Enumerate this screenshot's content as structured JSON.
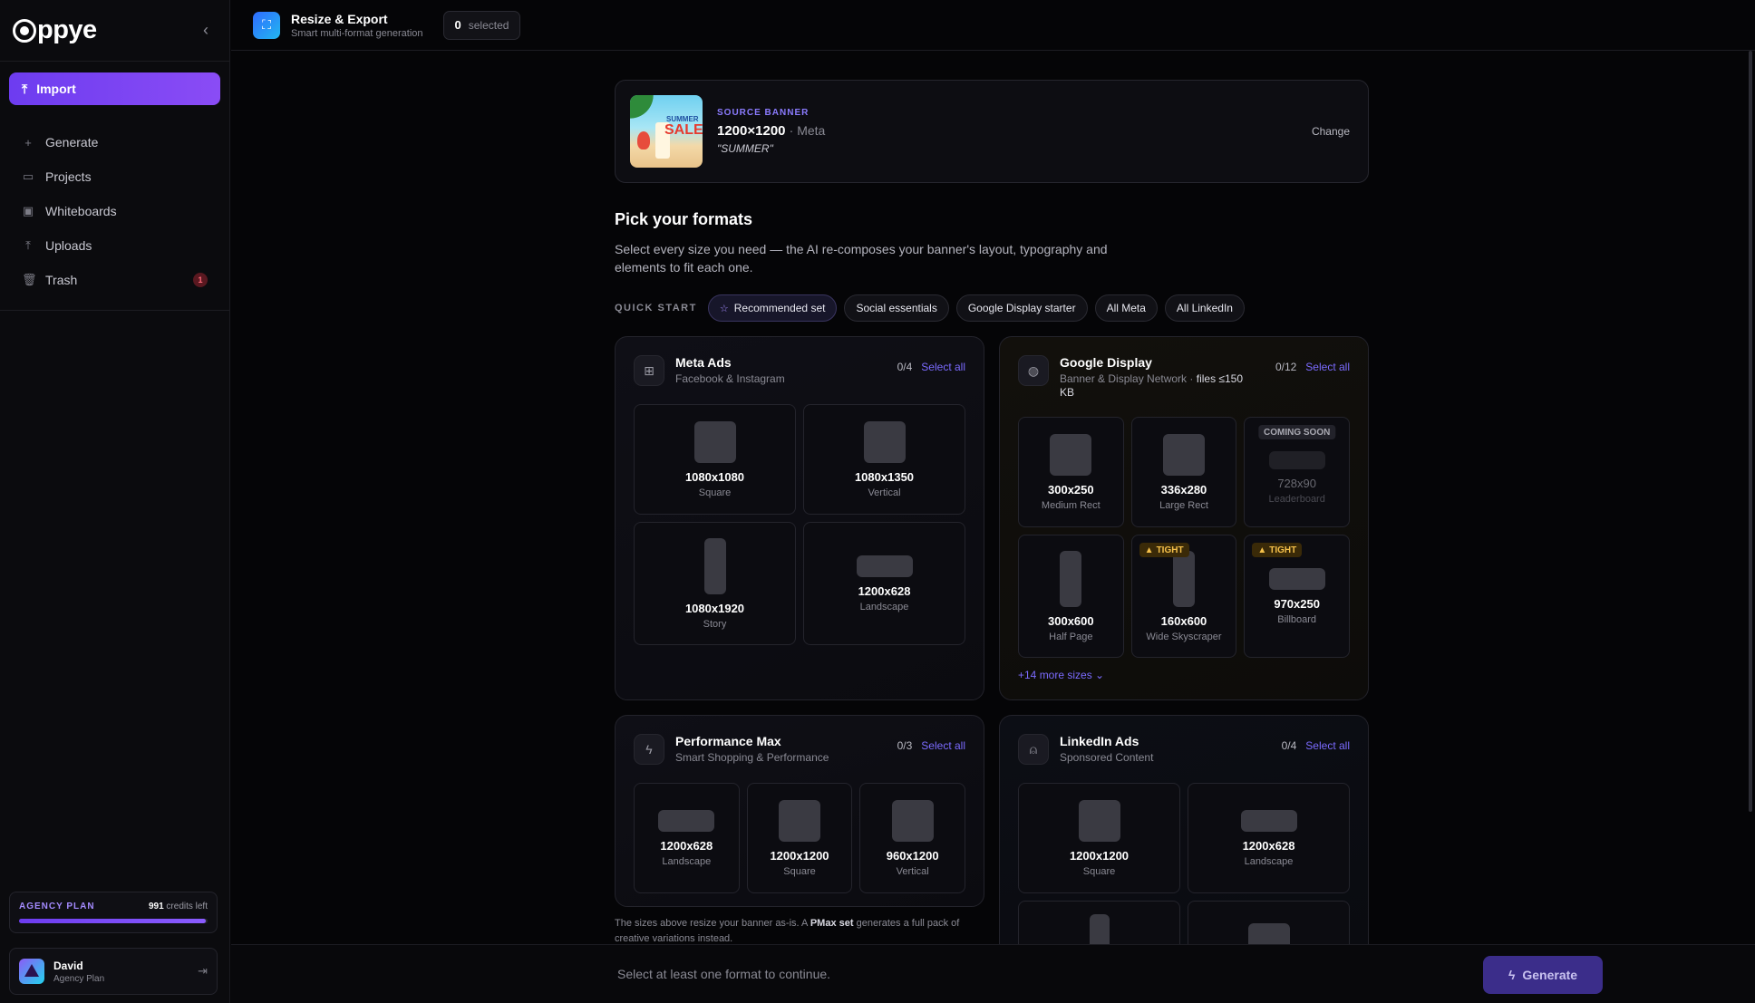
{
  "sidebar": {
    "logo": "ppye",
    "import_label": "Import",
    "items": [
      {
        "label": "Generate",
        "icon": "plus-icon"
      },
      {
        "label": "Projects",
        "icon": "folder-icon"
      },
      {
        "label": "Whiteboards",
        "icon": "whiteboard-icon"
      },
      {
        "label": "Uploads",
        "icon": "upload-icon"
      },
      {
        "label": "Trash",
        "icon": "trash-icon",
        "badge": "1"
      }
    ],
    "plan": {
      "name": "AGENCY PLAN",
      "credits": "991",
      "credits_suffix": "credits left",
      "usage_fraction": 0.99
    },
    "user": {
      "name": "David",
      "plan": "Agency Plan"
    }
  },
  "topbar": {
    "title": "Resize & Export",
    "subtitle": "Smart multi-format generation",
    "selected_count": "0",
    "selected_label": "selected"
  },
  "source": {
    "label": "SOURCE BANNER",
    "size": "1200×1200",
    "platform": "· Meta",
    "name": "\"SUMMER\"",
    "change_label": "Change",
    "thumb_text_top": "SUMMER",
    "thumb_text_big": "SALE"
  },
  "formats": {
    "title": "Pick your formats",
    "description": "Select every size you need — the AI re-composes your banner's layout, typography and elements to fit each one.",
    "quick_start_label": "QUICK START",
    "chips": [
      "Recommended set",
      "Social essentials",
      "Google Display starter",
      "All Meta",
      "All LinkedIn"
    ]
  },
  "groups": {
    "meta": {
      "title": "Meta Ads",
      "subtitle": "Facebook & Instagram",
      "count": "0/4",
      "select_all": "Select all",
      "tiles": [
        {
          "dim": "1080x1080",
          "name": "Square"
        },
        {
          "dim": "1080x1350",
          "name": "Vertical"
        },
        {
          "dim": "1080x1920",
          "name": "Story"
        },
        {
          "dim": "1200x628",
          "name": "Landscape"
        }
      ]
    },
    "google": {
      "title": "Google Display",
      "subtitle": "Banner & Display Network ·",
      "subtitle_bold": "files ≤150 KB",
      "count": "0/12",
      "select_all": "Select all",
      "tiles": [
        {
          "dim": "300x250",
          "name": "Medium Rect"
        },
        {
          "dim": "336x280",
          "name": "Large Rect"
        },
        {
          "dim": "728x90",
          "name": "Leaderboard",
          "tag": "COMING SOON"
        },
        {
          "dim": "300x600",
          "name": "Half Page"
        },
        {
          "dim": "160x600",
          "name": "Wide Skyscraper",
          "tag": "TIGHT"
        },
        {
          "dim": "970x250",
          "name": "Billboard",
          "tag": "TIGHT"
        }
      ],
      "more": "+14 more sizes"
    },
    "pmax": {
      "title": "Performance Max",
      "subtitle": "Smart Shopping & Performance",
      "count": "0/3",
      "select_all": "Select all",
      "tiles": [
        {
          "dim": "1200x628",
          "name": "Landscape"
        },
        {
          "dim": "1200x1200",
          "name": "Square"
        },
        {
          "dim": "960x1200",
          "name": "Vertical"
        }
      ],
      "footnote_a": "The sizes above resize your banner as-is. A",
      "footnote_b": "PMax set",
      "footnote_c": "generates a full pack of creative variations instead."
    },
    "linkedin": {
      "title": "LinkedIn Ads",
      "subtitle": "Sponsored Content",
      "count": "0/4",
      "select_all": "Select all",
      "tiles": [
        {
          "dim": "1200x1200",
          "name": "Square"
        },
        {
          "dim": "1200x628",
          "name": "Landscape"
        }
      ]
    }
  },
  "bottombar": {
    "hint": "Select at least one format to continue.",
    "generate_label": "Generate"
  },
  "colors": {
    "accent": "#7b6bff",
    "import": "#7a44f2",
    "warning": "#f5c04a"
  }
}
